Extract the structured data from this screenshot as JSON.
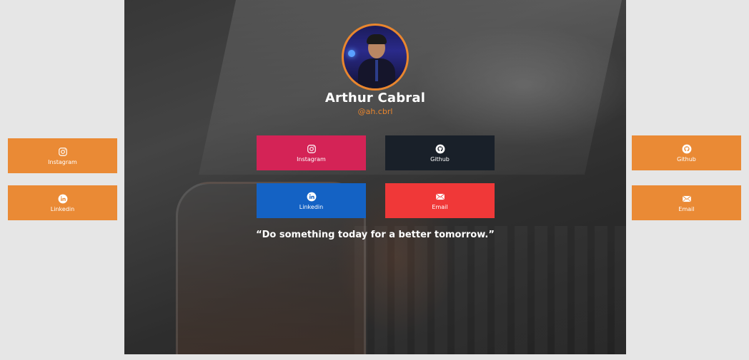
{
  "profile": {
    "name": "Arthur Cabral",
    "handle": "@ah.cbrl",
    "quote": "“Do something today for a better tomorrow.”"
  },
  "center_buttons": {
    "instagram": {
      "label": "Instagram",
      "icon": "instagram-icon",
      "color": "#d42356"
    },
    "github": {
      "label": "Github",
      "icon": "github-icon",
      "color": "#192029"
    },
    "linkedin": {
      "label": "Linkedin",
      "icon": "linkedin-icon",
      "color": "#1462c4"
    },
    "email": {
      "label": "Email",
      "icon": "email-icon",
      "color": "#f03838"
    }
  },
  "left_buttons": {
    "instagram": {
      "label": "Instagram",
      "icon": "instagram-icon"
    },
    "linkedin": {
      "label": "Linkedin",
      "icon": "linkedin-icon"
    }
  },
  "right_buttons": {
    "github": {
      "label": "Github",
      "icon": "github-icon"
    },
    "email": {
      "label": "Email",
      "icon": "email-icon"
    }
  },
  "colors": {
    "accent": "#e9862e",
    "side_button": "#ea8a35",
    "page_background": "#e6e6e6"
  }
}
